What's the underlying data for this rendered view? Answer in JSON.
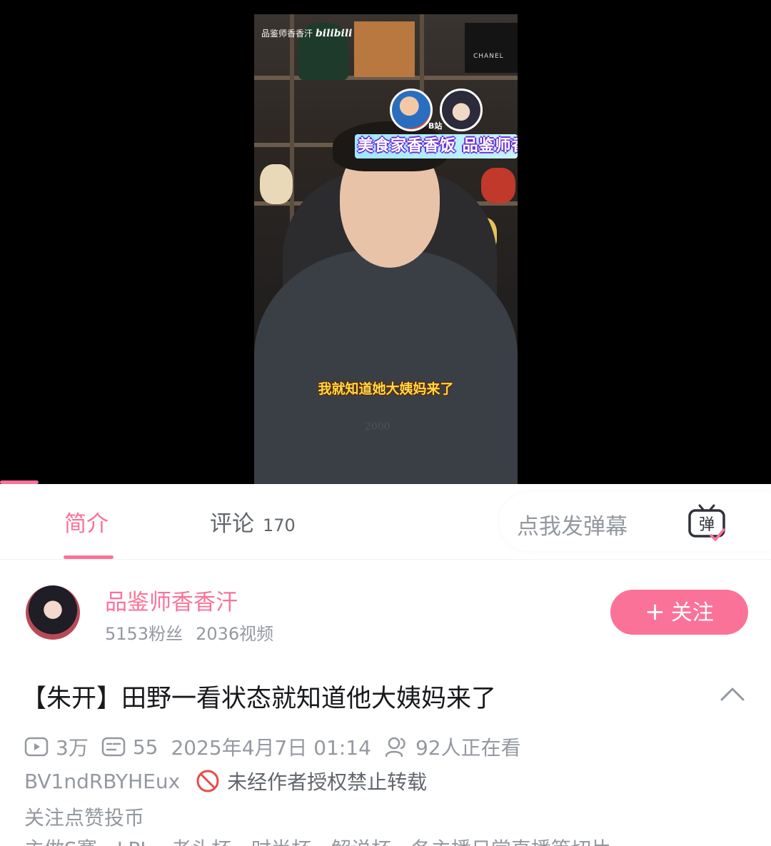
{
  "video": {
    "watermark_text": "品鉴师香香汗",
    "watermark_logo": "bilibili",
    "box_brand": "CHANEL",
    "bubble_tag": "B站",
    "name_banner": "美食家香香饭 品鉴师香香汗",
    "subtitle": "我就知道她大姨妈来了",
    "sweater_text": "2000",
    "progress_fraction": 0.05
  },
  "tabs": {
    "intro_label": "简介",
    "comments_label": "评论",
    "comments_count": "170",
    "danmaku_placeholder": "点我发弹幕",
    "danmaku_icon_char": "弹"
  },
  "uploader": {
    "name": "品鉴师香香汗",
    "fans": "5153粉丝",
    "videos": "2036视频",
    "follow_label": "关注",
    "follow_plus": "+"
  },
  "info": {
    "title": "【朱开】田野一看状态就知道他大姨妈来了",
    "views": "3万",
    "danmaku_count": "55",
    "date": "2025年4月7日 01:14",
    "watching": "92人正在看",
    "bvid": "BV1ndRBYHEux",
    "repost_notice": "未经作者授权禁止转载",
    "desc_line1": "关注点赞投币",
    "desc_line2": "主做S赛、LPL、老头杯、时尚杯、解说杯、各主播日常直播等切片"
  },
  "colors": {
    "accent": "#fb7299",
    "text_primary": "#18191c",
    "text_secondary": "#9499a0",
    "danger": "#e84b4b"
  },
  "icons": {
    "play": "play-count-icon",
    "danmaku": "danmaku-count-icon",
    "watching": "watching-people-icon",
    "ban": "no-repost-icon",
    "collapse": "chevron-up-icon",
    "danmaku_toggle": "danmaku-tv-icon"
  }
}
